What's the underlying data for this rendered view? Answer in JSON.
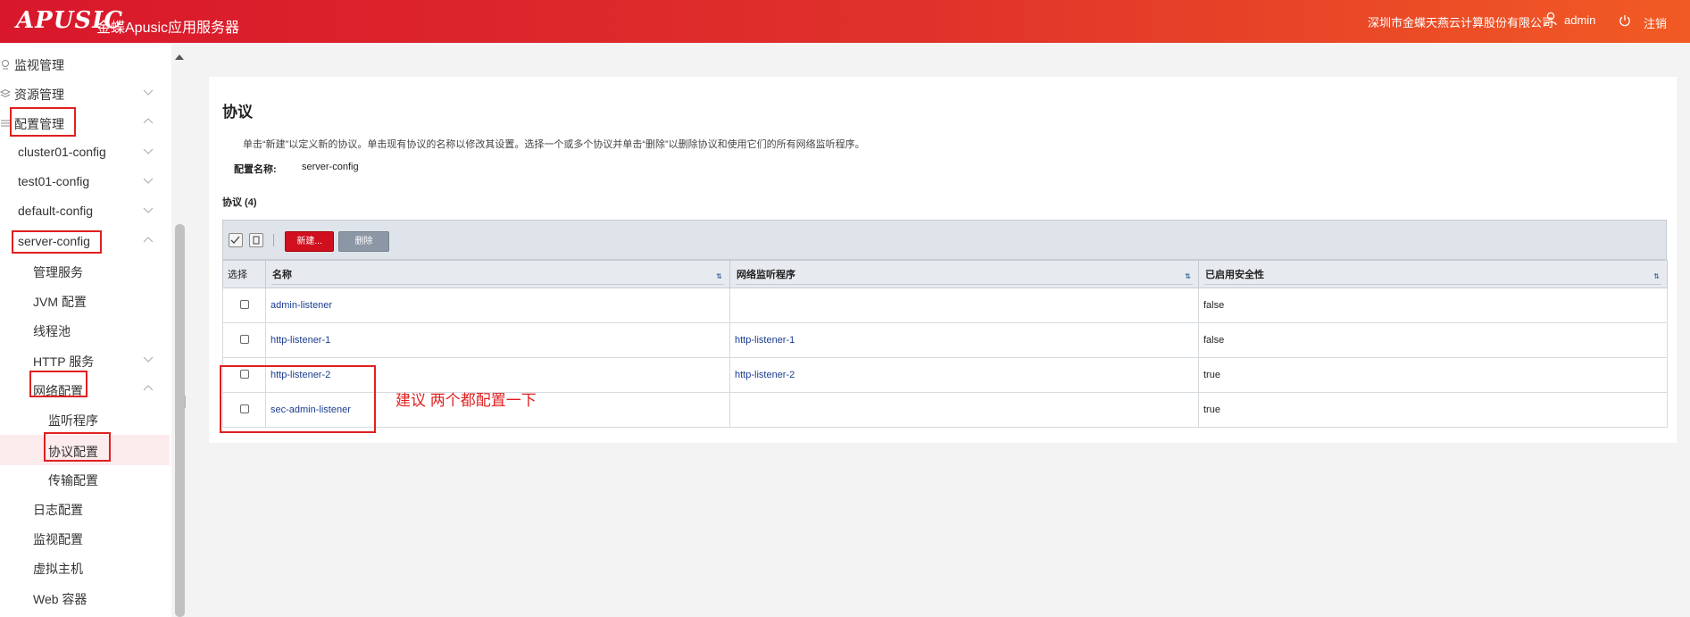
{
  "header": {
    "logo": "APUSIC",
    "app_title": "金蝶Apusic应用服务器",
    "company": "深圳市金蝶天燕云计算股份有限公司",
    "user": "admin",
    "logout": "注销"
  },
  "sidebar": {
    "items": [
      {
        "label": "监视管理"
      },
      {
        "label": "资源管理"
      },
      {
        "label": "配置管理"
      },
      {
        "label": "cluster01-config"
      },
      {
        "label": "test01-config"
      },
      {
        "label": "default-config"
      },
      {
        "label": "server-config"
      },
      {
        "label": "管理服务"
      },
      {
        "label": "JVM 配置"
      },
      {
        "label": "线程池"
      },
      {
        "label": "HTTP 服务"
      },
      {
        "label": "网络配置"
      },
      {
        "label": "监听程序"
      },
      {
        "label": "协议配置"
      },
      {
        "label": "传输配置"
      },
      {
        "label": "日志配置"
      },
      {
        "label": "监视配置"
      },
      {
        "label": "虚拟主机"
      },
      {
        "label": "Web 容器"
      }
    ]
  },
  "main": {
    "title": "协议",
    "help": "单击“新建”以定义新的协议。单击现有协议的名称以修改其设置。选择一个或多个协议并单击“删除”以删除协议和使用它们的所有网络监听程序。",
    "config_label": "配置名称:",
    "config_value": "server-config",
    "table_caption": "协议 (4)",
    "new_button": "新建...",
    "delete_button": "删除",
    "columns": [
      "选择",
      "名称",
      "网络监听程序",
      "已启用安全性"
    ],
    "rows": [
      {
        "name": "admin-listener",
        "listener": "",
        "security": "false"
      },
      {
        "name": "http-listener-1",
        "listener": "http-listener-1",
        "security": "false"
      },
      {
        "name": "http-listener-2",
        "listener": "http-listener-2",
        "security": "true"
      },
      {
        "name": "sec-admin-listener",
        "listener": "",
        "security": "true"
      }
    ]
  },
  "annotation": {
    "text": "建议 两个都配置一下",
    "color": "#e02020"
  },
  "colors": {
    "header_start": "#d8172b",
    "header_end": "#f15a24",
    "new_button": "#d0101f",
    "link": "#1a3d8f"
  }
}
